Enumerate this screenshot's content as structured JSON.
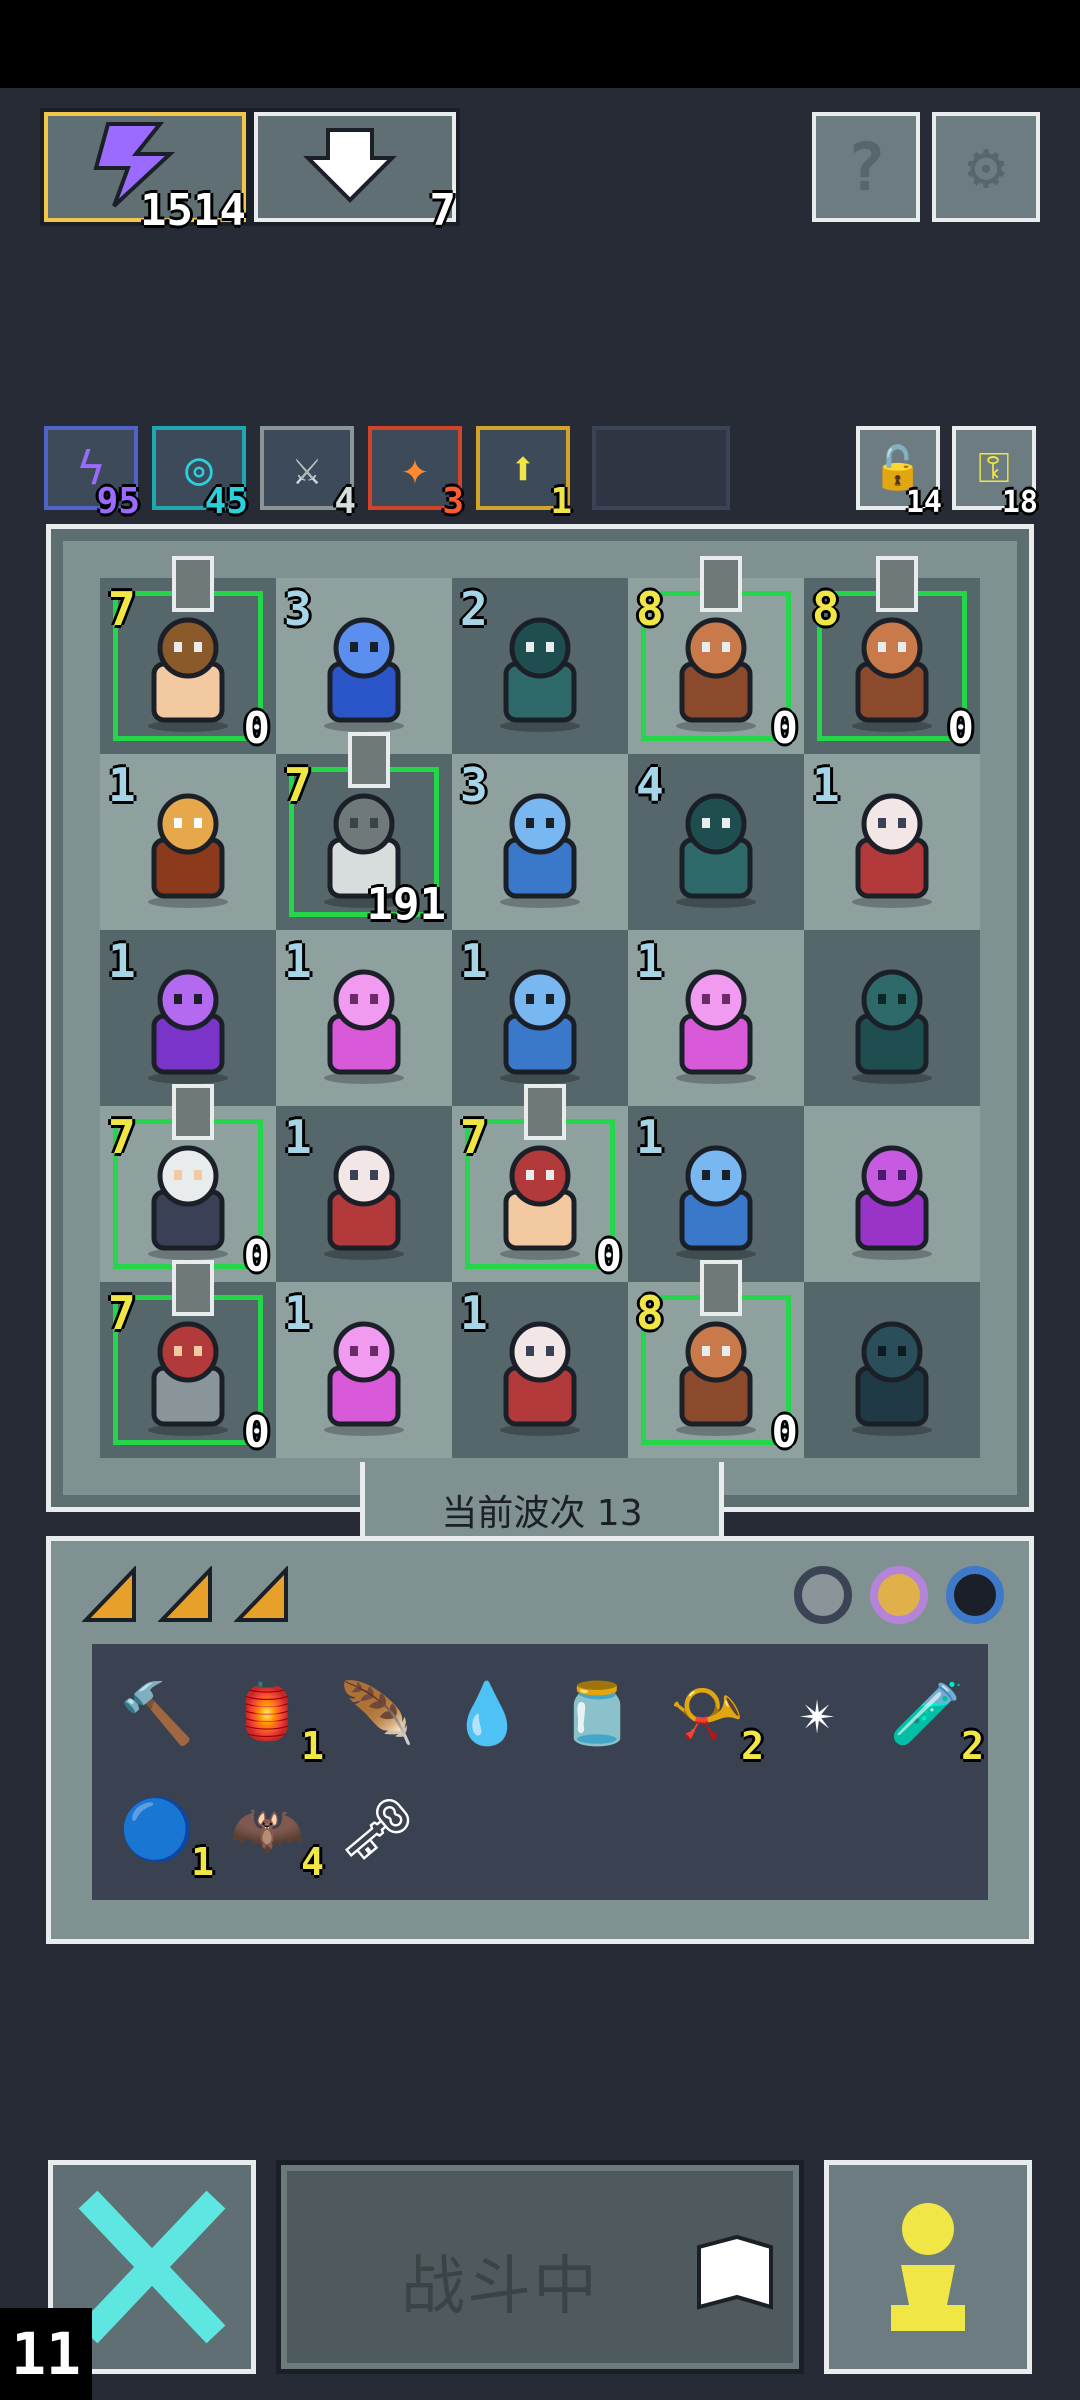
{
  "resources": {
    "energy": "1514",
    "drop": "7"
  },
  "buffs": [
    {
      "count": "95",
      "color": "#9b6bff"
    },
    {
      "count": "45",
      "color": "#2ad0dc"
    },
    {
      "count": "4",
      "color": "#d7dddd"
    },
    {
      "count": "3",
      "color": "#ff5a2e"
    },
    {
      "count": "1",
      "color": "#f0e646"
    }
  ],
  "side_slots": {
    "left": "14",
    "right": "18"
  },
  "board": {
    "cells": [
      {
        "lvl": "7",
        "lvlColor": "#f0e646",
        "sub": "0",
        "sprite": "knight-hero",
        "lock": true,
        "outline": true
      },
      {
        "lvl": "3",
        "lvlColor": "#a6d5e8",
        "sub": "",
        "sprite": "blue-cube",
        "lock": false,
        "outline": false
      },
      {
        "lvl": "2",
        "lvlColor": "#a6d5e8",
        "sub": "",
        "sprite": "teal-claw",
        "lock": false,
        "outline": false
      },
      {
        "lvl": "8",
        "lvlColor": "#f0e646",
        "sub": "0",
        "sprite": "crossed-swords",
        "lock": true,
        "outline": true
      },
      {
        "lvl": "8",
        "lvlColor": "#f0e646",
        "sub": "0",
        "sprite": "crossed-swords",
        "lock": true,
        "outline": true
      },
      {
        "lvl": "1",
        "lvlColor": "#a6d5e8",
        "sub": "",
        "sprite": "mimic-chest",
        "lock": false,
        "outline": false
      },
      {
        "lvl": "7",
        "lvlColor": "#f0e646",
        "sub": "191",
        "sprite": "skeleton-hero",
        "lock": true,
        "outline": true
      },
      {
        "lvl": "3",
        "lvlColor": "#a6d5e8",
        "sub": "",
        "sprite": "blue-golem",
        "lock": false,
        "outline": false
      },
      {
        "lvl": "4",
        "lvlColor": "#a6d5e8",
        "sub": "",
        "sprite": "teal-claw",
        "lock": false,
        "outline": false
      },
      {
        "lvl": "1",
        "lvlColor": "#a6d5e8",
        "sub": "",
        "sprite": "red-hair-girl",
        "lock": false,
        "outline": false
      },
      {
        "lvl": "1",
        "lvlColor": "#a6d5e8",
        "sub": "",
        "sprite": "purple-totem",
        "lock": false,
        "outline": false
      },
      {
        "lvl": "1",
        "lvlColor": "#a6d5e8",
        "sub": "",
        "sprite": "pink-demon",
        "lock": false,
        "outline": false
      },
      {
        "lvl": "1",
        "lvlColor": "#a6d5e8",
        "sub": "",
        "sprite": "blue-golem",
        "lock": false,
        "outline": false
      },
      {
        "lvl": "1",
        "lvlColor": "#a6d5e8",
        "sub": "",
        "sprite": "pink-demon",
        "lock": false,
        "outline": false
      },
      {
        "lvl": "",
        "lvlColor": "#a6d5e8",
        "sub": "",
        "sprite": "teal-slime",
        "lock": false,
        "outline": false
      },
      {
        "lvl": "7",
        "lvlColor": "#f0e646",
        "sub": "0",
        "sprite": "bearded-hero",
        "lock": true,
        "outline": true
      },
      {
        "lvl": "1",
        "lvlColor": "#a6d5e8",
        "sub": "",
        "sprite": "red-hair-girl",
        "lock": false,
        "outline": false
      },
      {
        "lvl": "7",
        "lvlColor": "#f0e646",
        "sub": "0",
        "sprite": "mage-hero",
        "lock": true,
        "outline": true
      },
      {
        "lvl": "1",
        "lvlColor": "#a6d5e8",
        "sub": "",
        "sprite": "blue-golem",
        "lock": false,
        "outline": false
      },
      {
        "lvl": "",
        "lvlColor": "#a6d5e8",
        "sub": "",
        "sprite": "purple-demon",
        "lock": false,
        "outline": false
      },
      {
        "lvl": "7",
        "lvlColor": "#f0e646",
        "sub": "0",
        "sprite": "armored-hero",
        "lock": true,
        "outline": true
      },
      {
        "lvl": "1",
        "lvlColor": "#a6d5e8",
        "sub": "",
        "sprite": "pink-demon",
        "lock": false,
        "outline": false
      },
      {
        "lvl": "1",
        "lvlColor": "#a6d5e8",
        "sub": "",
        "sprite": "red-hair-girl",
        "lock": false,
        "outline": false
      },
      {
        "lvl": "8",
        "lvlColor": "#f0e646",
        "sub": "0",
        "sprite": "crossed-swords",
        "lock": true,
        "outline": true
      },
      {
        "lvl": "",
        "lvlColor": "#a6d5e8",
        "sub": "",
        "sprite": "dark-blob",
        "lock": false,
        "outline": false
      }
    ]
  },
  "wave_label": "当前波次 13",
  "inventory": [
    {
      "name": "hammer-icon",
      "glyph": "🔨",
      "count": ""
    },
    {
      "name": "lantern-icon",
      "glyph": "🏮",
      "count": "1"
    },
    {
      "name": "feather-icon",
      "glyph": "🪶",
      "count": ""
    },
    {
      "name": "water-tile-icon",
      "glyph": "💧",
      "count": ""
    },
    {
      "name": "jar-icon",
      "glyph": "🫙",
      "count": ""
    },
    {
      "name": "horn-icon",
      "glyph": "📯",
      "count": "2"
    },
    {
      "name": "shuriken-icon",
      "glyph": "✴",
      "count": ""
    },
    {
      "name": "potion-icon",
      "glyph": "🧪",
      "count": "2"
    },
    {
      "name": "orb-icon",
      "glyph": "🔵",
      "count": "1"
    },
    {
      "name": "claw-icon",
      "glyph": "🦇",
      "count": "4"
    },
    {
      "name": "key-icon",
      "glyph": "🗝",
      "count": ""
    }
  ],
  "battle_label": "战斗中",
  "corner_counter": "11"
}
